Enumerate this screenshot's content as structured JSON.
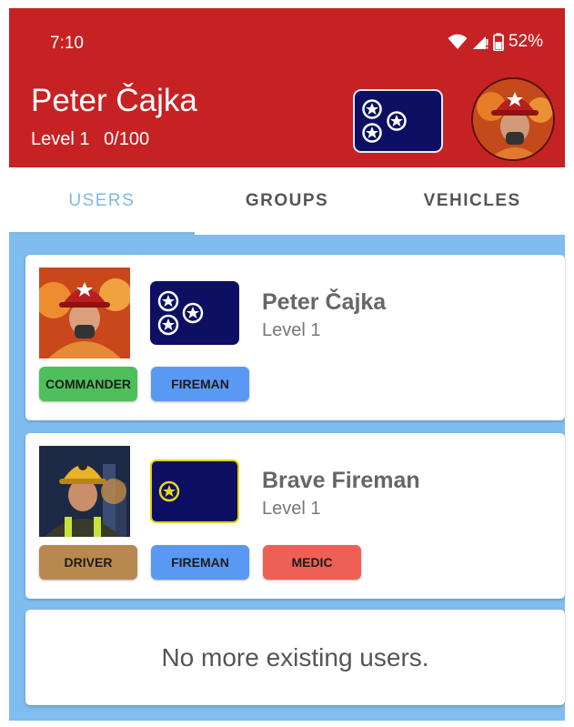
{
  "status_bar": {
    "time": "7:10",
    "battery": "52%"
  },
  "header": {
    "user_name": "Peter Čajka",
    "level": "Level 1",
    "xp": "0/100"
  },
  "tabs": [
    {
      "label": "USERS",
      "active": true
    },
    {
      "label": "GROUPS",
      "active": false
    },
    {
      "label": "VEHICLES",
      "active": false
    }
  ],
  "users": [
    {
      "name": "Peter Čajka",
      "level": "Level 1",
      "badge": "navy-flag-three-stars",
      "roles": [
        {
          "label": "COMMANDER",
          "color": "#4fbf5c"
        },
        {
          "label": "FIREMAN",
          "color": "#5a99f3"
        }
      ]
    },
    {
      "name": "Brave Fireman",
      "level": "Level 1",
      "badge": "navy-flag-one-gold-star",
      "roles": [
        {
          "label": "DRIVER",
          "color": "#b8894f"
        },
        {
          "label": "FIREMAN",
          "color": "#5a99f3"
        },
        {
          "label": "MEDIC",
          "color": "#ee6055"
        }
      ]
    }
  ],
  "empty_message": "No more existing users.",
  "colors": {
    "header_bg": "#c62224",
    "content_bg": "#7fbcf0",
    "active_tab": "#7cb8e8",
    "flag_navy": "#0d0f63"
  }
}
